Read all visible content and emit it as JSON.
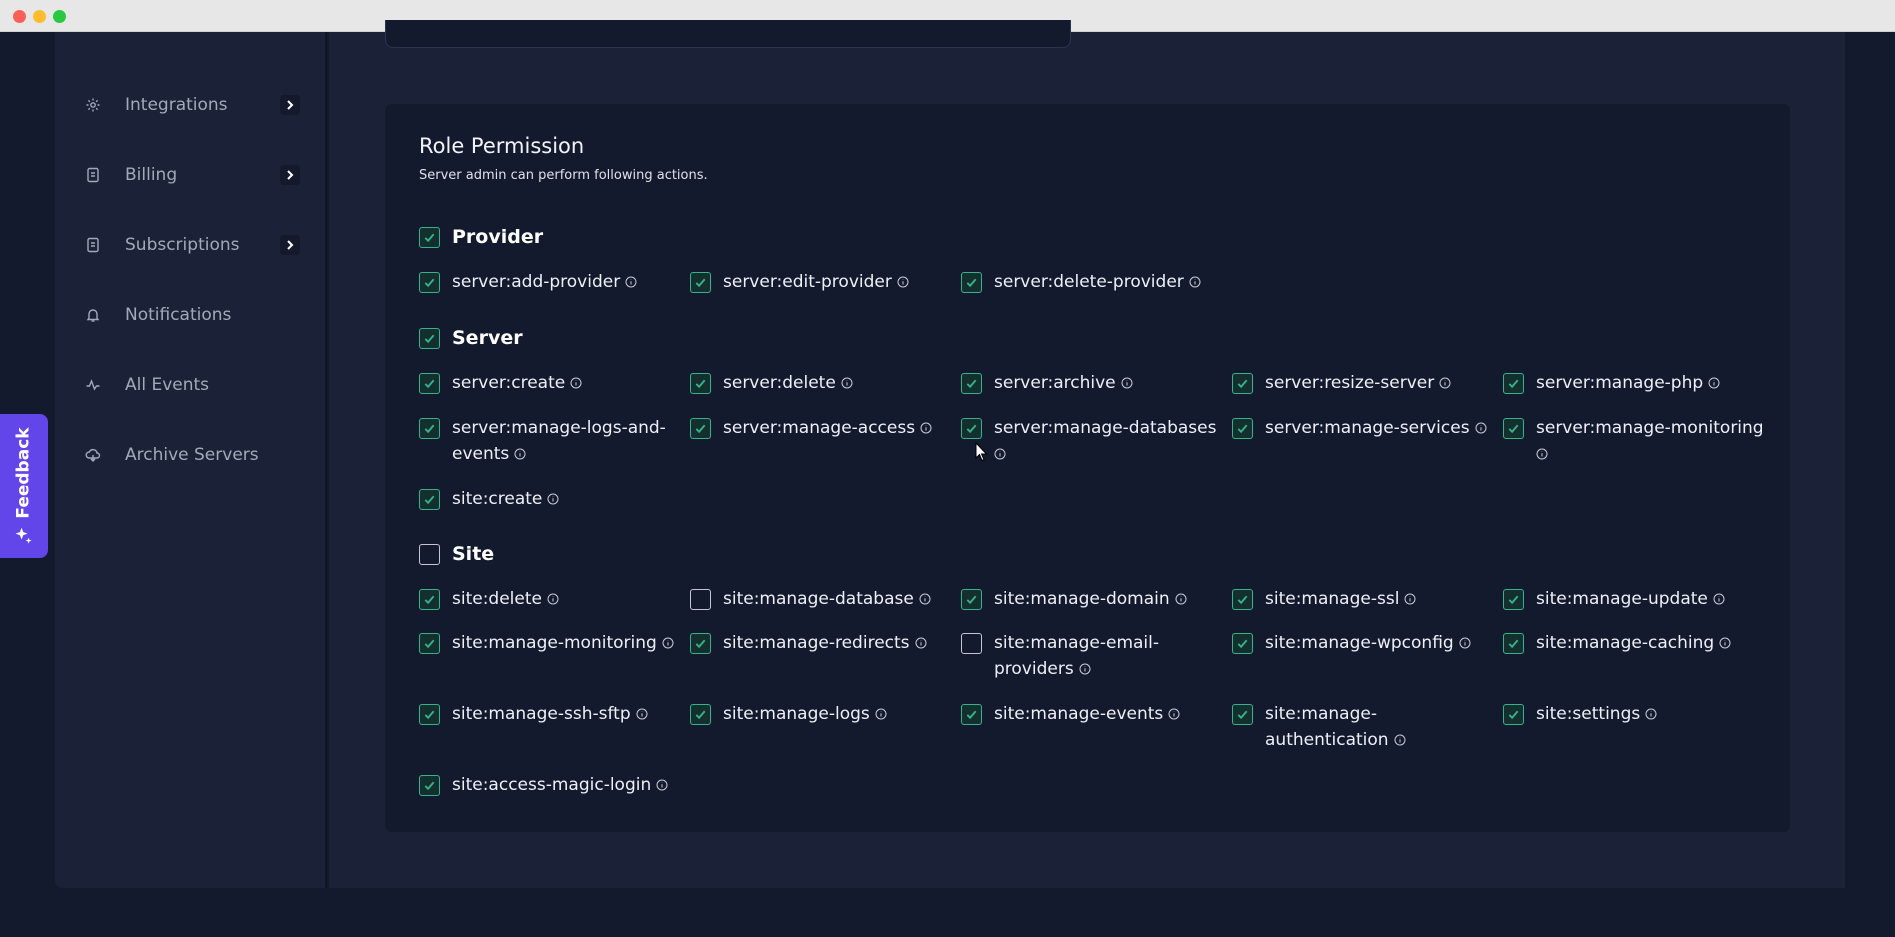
{
  "sidebar": {
    "items": [
      {
        "label": "Integrations",
        "icon": "gear-icon",
        "has_submenu": true
      },
      {
        "label": "Billing",
        "icon": "receipt-icon",
        "has_submenu": true
      },
      {
        "label": "Subscriptions",
        "icon": "receipt-icon",
        "has_submenu": true
      },
      {
        "label": "Notifications",
        "icon": "bell-icon",
        "has_submenu": false
      },
      {
        "label": "All Events",
        "icon": "activity-icon",
        "has_submenu": false
      },
      {
        "label": "Archive Servers",
        "icon": "cloud-archive-icon",
        "has_submenu": false
      }
    ]
  },
  "feedback": {
    "label": "Feedback",
    "icon": "sparkle-icon"
  },
  "role_permission": {
    "title": "Role Permission",
    "subtitle": "Server admin can perform following actions.",
    "sections": [
      {
        "name": "Provider",
        "checked": true,
        "permissions": [
          {
            "label": "server:add-provider",
            "checked": true
          },
          {
            "label": "server:edit-provider",
            "checked": true
          },
          {
            "label": "server:delete-provider",
            "checked": true
          }
        ]
      },
      {
        "name": "Server",
        "checked": true,
        "permissions": [
          {
            "label": "server:create",
            "checked": true
          },
          {
            "label": "server:delete",
            "checked": true
          },
          {
            "label": "server:archive",
            "checked": true
          },
          {
            "label": "server:resize-server",
            "checked": true
          },
          {
            "label": "server:manage-php",
            "checked": true
          },
          {
            "label": "server:manage-logs-and-events",
            "label_lines": [
              "server:manage-logs-and-",
              "events"
            ],
            "checked": true
          },
          {
            "label": "server:manage-access",
            "checked": true
          },
          {
            "label": "server:manage-databases",
            "label_lines": [
              "server:manage-databases",
              ""
            ],
            "checked": true
          },
          {
            "label": "server:manage-services",
            "checked": true
          },
          {
            "label": "server:manage-monitoring",
            "label_lines": [
              "server:manage-monitoring",
              ""
            ],
            "checked": true
          },
          {
            "label": "site:create",
            "checked": true
          }
        ]
      },
      {
        "name": "Site",
        "checked": false,
        "permissions": [
          {
            "label": "site:delete",
            "checked": true
          },
          {
            "label": "site:manage-database",
            "checked": false
          },
          {
            "label": "site:manage-domain",
            "checked": true
          },
          {
            "label": "site:manage-ssl",
            "checked": true
          },
          {
            "label": "site:manage-update",
            "checked": true
          },
          {
            "label": "site:manage-monitoring",
            "checked": true
          },
          {
            "label": "site:manage-redirects",
            "checked": true
          },
          {
            "label": "site:manage-email-providers",
            "label_lines": [
              "site:manage-email-",
              "providers"
            ],
            "checked": false
          },
          {
            "label": "site:manage-wpconfig",
            "checked": true
          },
          {
            "label": "site:manage-caching",
            "checked": true
          },
          {
            "label": "site:manage-ssh-sftp",
            "checked": true
          },
          {
            "label": "site:manage-logs",
            "checked": true
          },
          {
            "label": "site:manage-events",
            "checked": true
          },
          {
            "label": "site:manage-authentication",
            "label_lines": [
              "site:manage-",
              "authentication"
            ],
            "checked": true
          },
          {
            "label": "site:settings",
            "checked": true
          },
          {
            "label": "site:access-magic-login",
            "checked": true
          }
        ]
      }
    ]
  },
  "colors": {
    "checked_accent": "#37b38c",
    "feedback_bg": "#6246ea",
    "card_bg": "#141a2e"
  }
}
